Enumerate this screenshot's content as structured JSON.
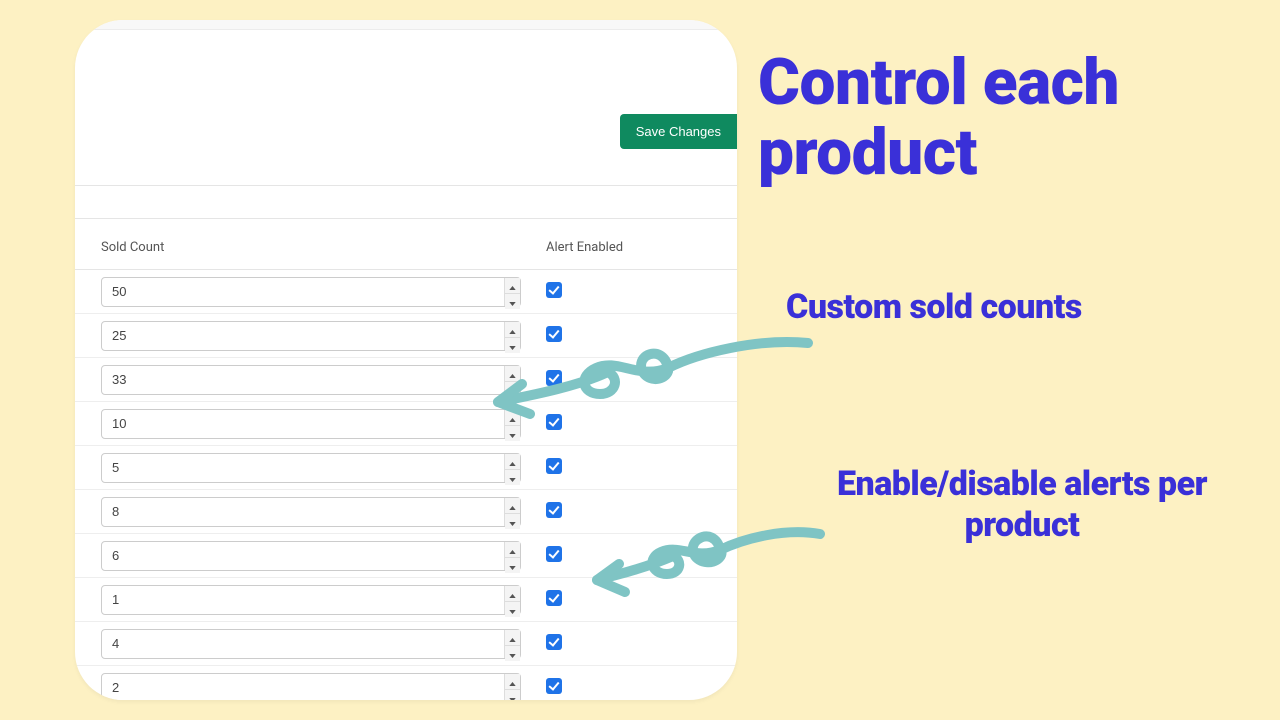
{
  "save_label": "Save Changes",
  "columns": {
    "sold": "Sold Count",
    "alert": "Alert Enabled"
  },
  "rows": [
    {
      "sold": "50",
      "alert": true
    },
    {
      "sold": "25",
      "alert": true
    },
    {
      "sold": "33",
      "alert": true
    },
    {
      "sold": "10",
      "alert": true
    },
    {
      "sold": "5",
      "alert": true
    },
    {
      "sold": "8",
      "alert": true
    },
    {
      "sold": "6",
      "alert": true
    },
    {
      "sold": "1",
      "alert": true
    },
    {
      "sold": "4",
      "alert": true
    },
    {
      "sold": "2",
      "alert": true
    }
  ],
  "annotations": {
    "headline": "Control each product",
    "sub1": "Custom sold counts",
    "sub2": "Enable/disable alerts per product"
  },
  "colors": {
    "accent_button": "#0f8a5f",
    "checkbox": "#1f73e8",
    "annotation": "#3a30d8",
    "arrow": "#7fc4c4",
    "bg": "#fdf1c3"
  }
}
